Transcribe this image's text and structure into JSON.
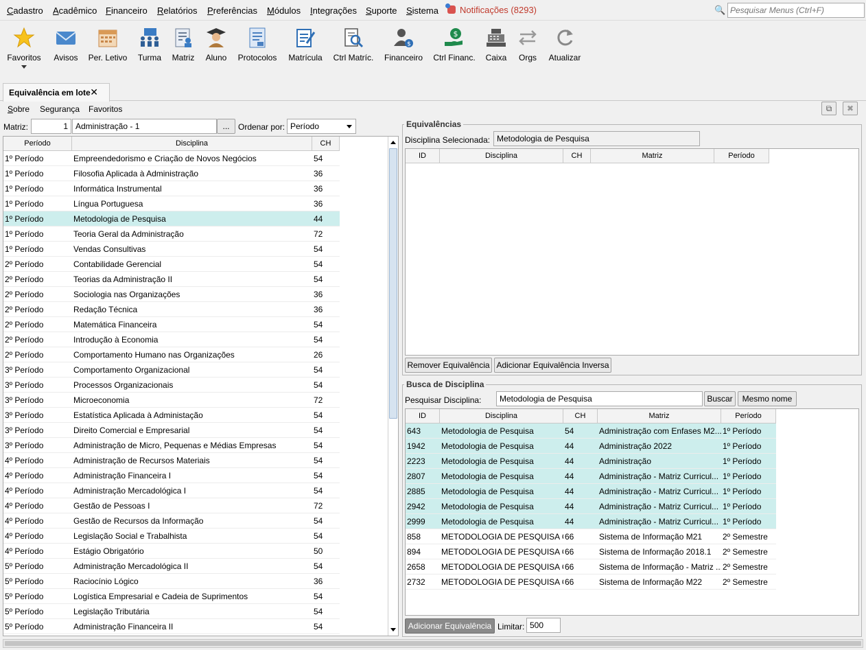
{
  "menu": {
    "items": [
      {
        "u": "C",
        "rest": "adastro"
      },
      {
        "u": "A",
        "rest": "cadêmico"
      },
      {
        "u": "F",
        "rest": "inanceiro"
      },
      {
        "u": "R",
        "rest": "elatórios"
      },
      {
        "u": "P",
        "rest": "referências"
      },
      {
        "u": "M",
        "rest": "ódulos"
      },
      {
        "u": "I",
        "rest": "ntegrações"
      },
      {
        "u": "S",
        "rest": "uporte"
      },
      {
        "u": "S",
        "rest": "istema"
      }
    ],
    "notifications": "Notificações (8293)",
    "search_placeholder": "Pesquisar Menus (Ctrl+F)"
  },
  "toolbar": {
    "items": [
      "Favoritos",
      "Avisos",
      "Per. Letivo",
      "Turma",
      "Matriz",
      "Aluno",
      "Protocolos",
      "Matrícula",
      "Ctrl Matríc.",
      "Financeiro",
      "Ctrl Financ.",
      "Caixa",
      "Orgs",
      "Atualizar"
    ]
  },
  "tab": {
    "title": "Equivalência em lote",
    "close": "✕"
  },
  "submenu": {
    "sobre_u": "S",
    "sobre_rest": "obre",
    "seguranca": "Segurança",
    "favoritos": "Favoritos"
  },
  "colors": {
    "selected_row": "#cdeeed",
    "notification": "#c0392b"
  },
  "left": {
    "matriz_label": "Matriz:",
    "matriz_id": "1",
    "matriz_name": "Administração - 1",
    "browse_button": "...",
    "ordenar_label": "Ordenar por:",
    "ordenar_value": "Período",
    "headers": [
      "Período",
      "Disciplina",
      "CH"
    ],
    "selected_index": 4,
    "rows": [
      [
        "1º Período",
        "Empreendedorismo e Criação de Novos Negócios",
        "54"
      ],
      [
        "1º Período",
        "Filosofia Aplicada à Administração",
        "36"
      ],
      [
        "1º Período",
        "Informática Instrumental",
        "36"
      ],
      [
        "1º Período",
        "Língua Portuguesa",
        "36"
      ],
      [
        "1º Período",
        "Metodologia de Pesquisa",
        "44"
      ],
      [
        "1º Período",
        "Teoria Geral da Administração",
        "72"
      ],
      [
        "1º Período",
        "Vendas Consultivas",
        "54"
      ],
      [
        "2º Período",
        "Contabilidade Gerencial",
        "54"
      ],
      [
        "2º Período",
        "Teorias da Administração II",
        "54"
      ],
      [
        "2º Período",
        "Sociologia nas Organizações",
        "36"
      ],
      [
        "2º Período",
        "Redação Técnica",
        "36"
      ],
      [
        "2º Período",
        "Matemática Financeira",
        "54"
      ],
      [
        "2º Período",
        "Introdução à Economia",
        "54"
      ],
      [
        "2º Período",
        "Comportamento Humano nas Organizações",
        "26"
      ],
      [
        "3º Período",
        "Comportamento Organizacional",
        "54"
      ],
      [
        "3º Período",
        "Processos Organizacionais",
        "54"
      ],
      [
        "3º Período",
        "Microeconomia",
        "72"
      ],
      [
        "3º Período",
        "Estatística Aplicada à Administação",
        "54"
      ],
      [
        "3º Período",
        "Direito Comercial e Empresarial",
        "54"
      ],
      [
        "3º Período",
        "Administração de Micro, Pequenas e Médias Empresas",
        "54"
      ],
      [
        "4º Período",
        "Administração de Recursos Materiais",
        "54"
      ],
      [
        "4º Período",
        "Administração Financeira I",
        "54"
      ],
      [
        "4º Período",
        "Administração Mercadológica I",
        "54"
      ],
      [
        "4º Período",
        "Gestão de Pessoas I",
        "72"
      ],
      [
        "4º Período",
        "Gestão de Recursos da Informação",
        "54"
      ],
      [
        "4º Período",
        "Legislação Social e Trabalhista",
        "54"
      ],
      [
        "4º Período",
        "Estágio Obrigatório",
        "50"
      ],
      [
        "5º Período",
        "Administração Mercadológica II",
        "54"
      ],
      [
        "5º Período",
        "Raciocínio Lógico",
        "36"
      ],
      [
        "5º Período",
        "Logística Empresarial e Cadeia de Suprimentos",
        "54"
      ],
      [
        "5º Período",
        "Legislação Tributária",
        "54"
      ],
      [
        "5º Período",
        "Administração Financeira II",
        "54"
      ]
    ]
  },
  "equivalencias": {
    "legend": "Equivalências",
    "selected_label": "Disciplina Selecionada:",
    "selected_value": "Metodologia de Pesquisa",
    "headers": [
      "ID",
      "Disciplina",
      "CH",
      "Matriz",
      "Período"
    ],
    "remove_button": "Remover Equivalência",
    "add_inverse_button": "Adicionar Equivalência Inversa"
  },
  "busca": {
    "legend": "Busca de Disciplina",
    "search_label": "Pesquisar Disciplina:",
    "search_value": "Metodologia de Pesquisa",
    "buscar_button": "Buscar",
    "mesmo_nome_button": "Mesmo nome",
    "headers": [
      "ID",
      "Disciplina",
      "CH",
      "Matriz",
      "Período"
    ],
    "highlighted_count": 7,
    "rows": [
      [
        "643",
        "Metodologia de Pesquisa",
        "54",
        "Administração com Enfases M2...",
        "1º Período"
      ],
      [
        "1942",
        "Metodologia de Pesquisa",
        "44",
        "Administração 2022",
        "1º Período"
      ],
      [
        "2223",
        "Metodologia de Pesquisa",
        "44",
        "Administração",
        "1º Período"
      ],
      [
        "2807",
        "Metodologia de Pesquisa",
        "44",
        "Administração - Matriz Curricul...",
        "1º Período"
      ],
      [
        "2885",
        "Metodologia de Pesquisa",
        "44",
        "Administração - Matriz Curricul...",
        "1º Período"
      ],
      [
        "2942",
        "Metodologia de Pesquisa",
        "44",
        "Administração - Matriz Curricul...",
        "1º Período"
      ],
      [
        "2999",
        "Metodologia de Pesquisa",
        "44",
        "Administração - Matriz Curricul...",
        "1º Período"
      ],
      [
        "858",
        "METODOLOGIA DE PESQUISA C...",
        "66",
        "Sistema de Informação M21",
        "2º Semestre"
      ],
      [
        "894",
        "METODOLOGIA DE PESQUISA C...",
        "66",
        "Sistema de Informação 2018.1",
        "2º Semestre"
      ],
      [
        "2658",
        "METODOLOGIA DE PESQUISA C...",
        "66",
        "Sistema de Informação - Matriz ...",
        "2º Semestre"
      ],
      [
        "2732",
        "METODOLOGIA DE PESQUISA C...",
        "66",
        "Sistema de Informação M22",
        "2º Semestre"
      ]
    ],
    "add_button": "Adicionar Equivalência",
    "limit_label": "Limitar:",
    "limit_value": "500"
  }
}
